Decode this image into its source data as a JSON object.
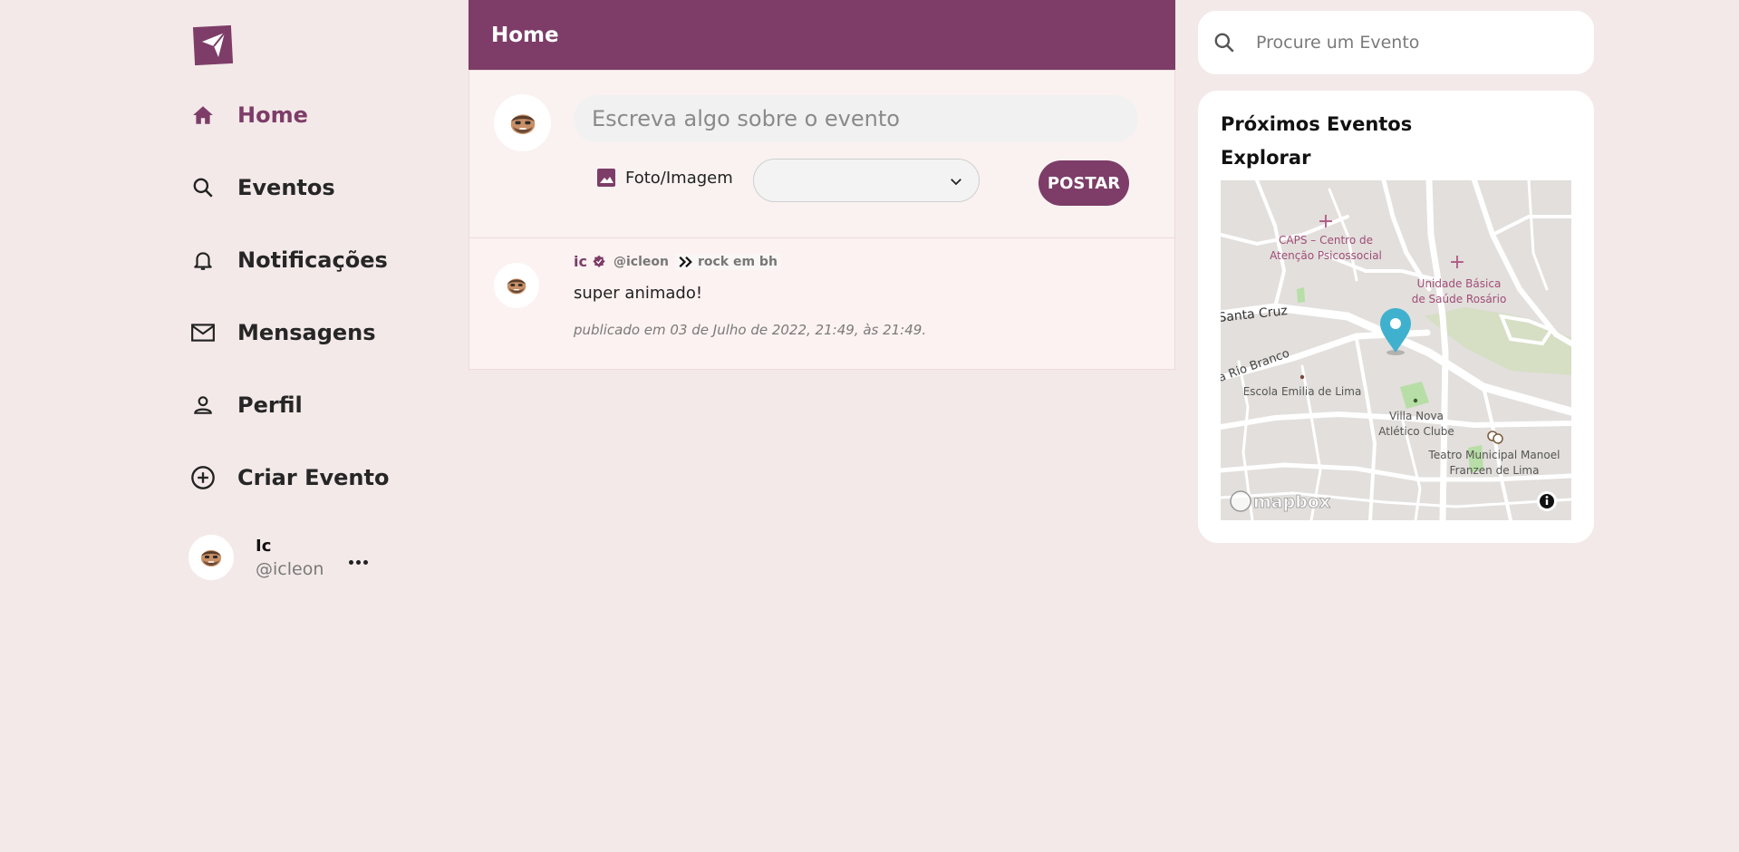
{
  "sidebar": {
    "logo_icon": "paper-plane-icon",
    "nav": [
      {
        "label": "Home",
        "icon": "home-icon",
        "active": true
      },
      {
        "label": "Eventos",
        "icon": "search-icon"
      },
      {
        "label": "Notificações",
        "icon": "bell-icon"
      },
      {
        "label": "Mensagens",
        "icon": "mail-icon"
      },
      {
        "label": "Perfil",
        "icon": "person-icon"
      },
      {
        "label": "Criar Evento",
        "icon": "plus-circle-icon"
      }
    ],
    "user": {
      "name": "Ic",
      "handle": "@icleon"
    }
  },
  "main": {
    "title": "Home",
    "composer": {
      "placeholder": "Escreva algo sobre o evento",
      "photo_label": "Foto/Imagem",
      "select_value": "",
      "post_label": "POSTAR"
    },
    "posts": [
      {
        "author": "ic",
        "handle": "@icleon",
        "event": "rock em bh",
        "text": "super animado!",
        "date": "publicado em 03 de Julho de 2022, 21:49, às 21:49."
      }
    ]
  },
  "right": {
    "search_placeholder": "Procure um Evento",
    "upcoming_title": "Próximos Eventos",
    "explore_title": "Explorar",
    "map": {
      "labels": {
        "caps1": "CAPS – Centro de",
        "caps2": "Atenção Psicossocial",
        "ubs1": "Unidade Básica",
        "ubs2": "de Saúde Rosário",
        "santa_cruz": "Santa Cruz",
        "rio_branco": "a Rio Branco",
        "escola": "Escola Emilia de Lima",
        "villa1": "Villa Nova",
        "villa2": "Atlético Clube",
        "teatro1": "Teatro Municipal Manoel",
        "teatro2": "Franzen de Lima",
        "brand": "mapbox"
      }
    }
  },
  "colors": {
    "brand": "#7d3d68",
    "background": "#f3e9e8",
    "pin": "#3fb1ce"
  }
}
